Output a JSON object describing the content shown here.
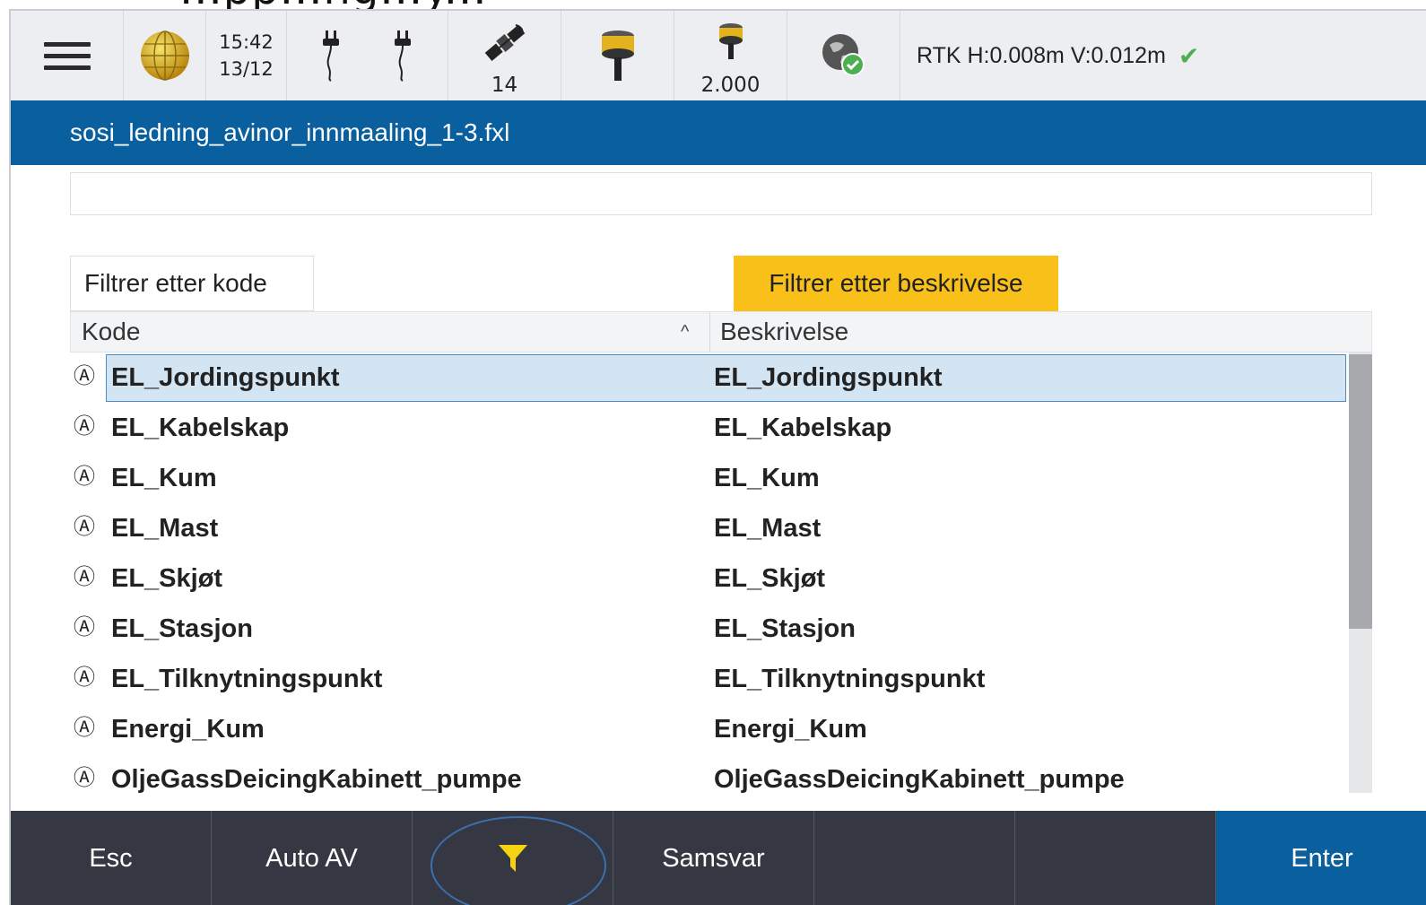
{
  "top_crop_text": "...pp...ng...y...",
  "status": {
    "time": "15:42",
    "date": "13/12",
    "satellites": "14",
    "antenna_height": "2.000",
    "rtk": "RTK H:0.008m V:0.012m",
    "check_icon": "check-icon"
  },
  "title": "sosi_ledning_avinor_innmaaling_1-3.fxl",
  "search": {
    "value": "",
    "placeholder": ""
  },
  "filters": {
    "by_code": "Filtrer etter kode",
    "by_description": "Filtrer etter beskrivelse"
  },
  "table": {
    "col_code": "Kode",
    "col_desc": "Beskrivelse",
    "sort_indicator": "^",
    "rows": [
      {
        "icon": "Ⓐ",
        "code": "EL_Jordingspunkt",
        "desc": "EL_Jordingspunkt"
      },
      {
        "icon": "Ⓐ",
        "code": "EL_Kabelskap",
        "desc": "EL_Kabelskap"
      },
      {
        "icon": "Ⓐ",
        "code": "EL_Kum",
        "desc": "EL_Kum"
      },
      {
        "icon": "Ⓐ",
        "code": "EL_Mast",
        "desc": "EL_Mast"
      },
      {
        "icon": "Ⓐ",
        "code": "EL_Skjøt",
        "desc": "EL_Skjøt"
      },
      {
        "icon": "Ⓐ",
        "code": "EL_Stasjon",
        "desc": "EL_Stasjon"
      },
      {
        "icon": "Ⓐ",
        "code": "EL_Tilknytningspunkt",
        "desc": "EL_Tilknytningspunkt"
      },
      {
        "icon": "Ⓐ",
        "code": "Energi_Kum",
        "desc": "Energi_Kum"
      },
      {
        "icon": "Ⓐ",
        "code": "OljeGassDeicingKabinett_pumpe",
        "desc": "OljeGassDeicingKabinett_pumpe"
      }
    ]
  },
  "bottom": {
    "esc": "Esc",
    "auto": "Auto AV",
    "match": "Samsvar",
    "enter": "Enter"
  },
  "colors": {
    "titlebar": "#0a5f9e",
    "accent_yellow": "#f9c01a",
    "bottombar": "#353842"
  }
}
